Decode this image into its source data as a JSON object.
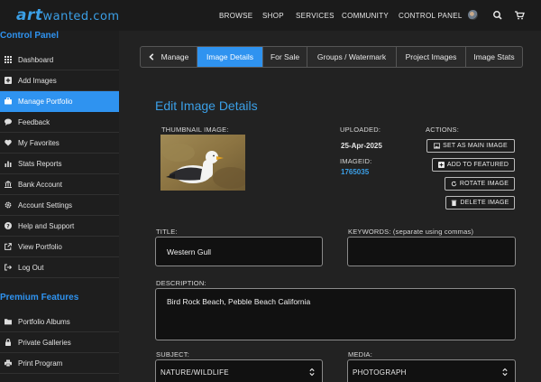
{
  "app": {
    "logo_art": "art",
    "logo_rest": "wanted.com"
  },
  "topnav": {
    "items": [
      "BROWSE",
      "SHOP",
      "SERVICES",
      "COMMUNITY",
      "CONTROL PANEL"
    ]
  },
  "sidebar": {
    "control_panel_title": "Control Panel",
    "items": [
      {
        "label": "Dashboard",
        "icon": "grid-icon"
      },
      {
        "label": "Add Images",
        "icon": "plus-square-icon"
      },
      {
        "label": "Manage Portfolio",
        "icon": "briefcase-icon"
      },
      {
        "label": "Feedback",
        "icon": "comment-icon"
      },
      {
        "label": "My Favorites",
        "icon": "heart-icon"
      },
      {
        "label": "Stats Reports",
        "icon": "bar-chart-icon"
      },
      {
        "label": "Bank Account",
        "icon": "bank-icon"
      },
      {
        "label": "Account Settings",
        "icon": "gear-icon"
      },
      {
        "label": "Help and Support",
        "icon": "question-icon"
      },
      {
        "label": "View Portfolio",
        "icon": "external-link-icon"
      },
      {
        "label": "Log Out",
        "icon": "logout-icon"
      }
    ],
    "premium_title": "Premium Features",
    "premium_items": [
      {
        "label": "Portfolio Albums",
        "icon": "folder-icon"
      },
      {
        "label": "Private Galleries",
        "icon": "lock-icon"
      },
      {
        "label": "Print Program",
        "icon": "print-icon"
      }
    ]
  },
  "tabs": [
    {
      "label": "Manage",
      "active": false
    },
    {
      "label": "Image Details",
      "active": true
    },
    {
      "label": "For Sale",
      "active": false
    },
    {
      "label": "Groups / Watermark",
      "active": false
    },
    {
      "label": "Project Images",
      "active": false
    },
    {
      "label": "Image Stats",
      "active": false
    }
  ],
  "main": {
    "heading": "Edit Image Details",
    "thumbnail_label": "THUMBNAIL IMAGE:",
    "uploaded_label": "UPLOADED:",
    "uploaded_value": "25-Apr-2025",
    "imageid_label": "IMAGEID:",
    "imageid_value": "1765035",
    "actions_label": "ACTIONS:",
    "actions": [
      {
        "label": "SET AS MAIN IMAGE",
        "icon": "image-icon"
      },
      {
        "label": "ADD TO FEATURED",
        "icon": "plus-square-icon"
      },
      {
        "label": "ROTATE IMAGE",
        "icon": "rotate-icon"
      },
      {
        "label": "DELETE IMAGE",
        "icon": "trash-icon"
      }
    ],
    "title_label": "TITLE:",
    "title_value": "Western Gull",
    "keywords_label": "KEYWORDS: (separate using commas)",
    "keywords_value": "",
    "description_label": "DESCRIPTION:",
    "description_value": "Bird Rock Beach, Pebble Beach California",
    "subject_label": "SUBJECT:",
    "subject_value": "NATURE/WILDLIFE",
    "media_label": "MEDIA:",
    "media_value": "PHOTOGRAPH"
  },
  "colors": {
    "accent": "#2f93f0",
    "background": "#222222",
    "sidebar": "#1e1e1e",
    "topbar": "#1b1b1b"
  }
}
